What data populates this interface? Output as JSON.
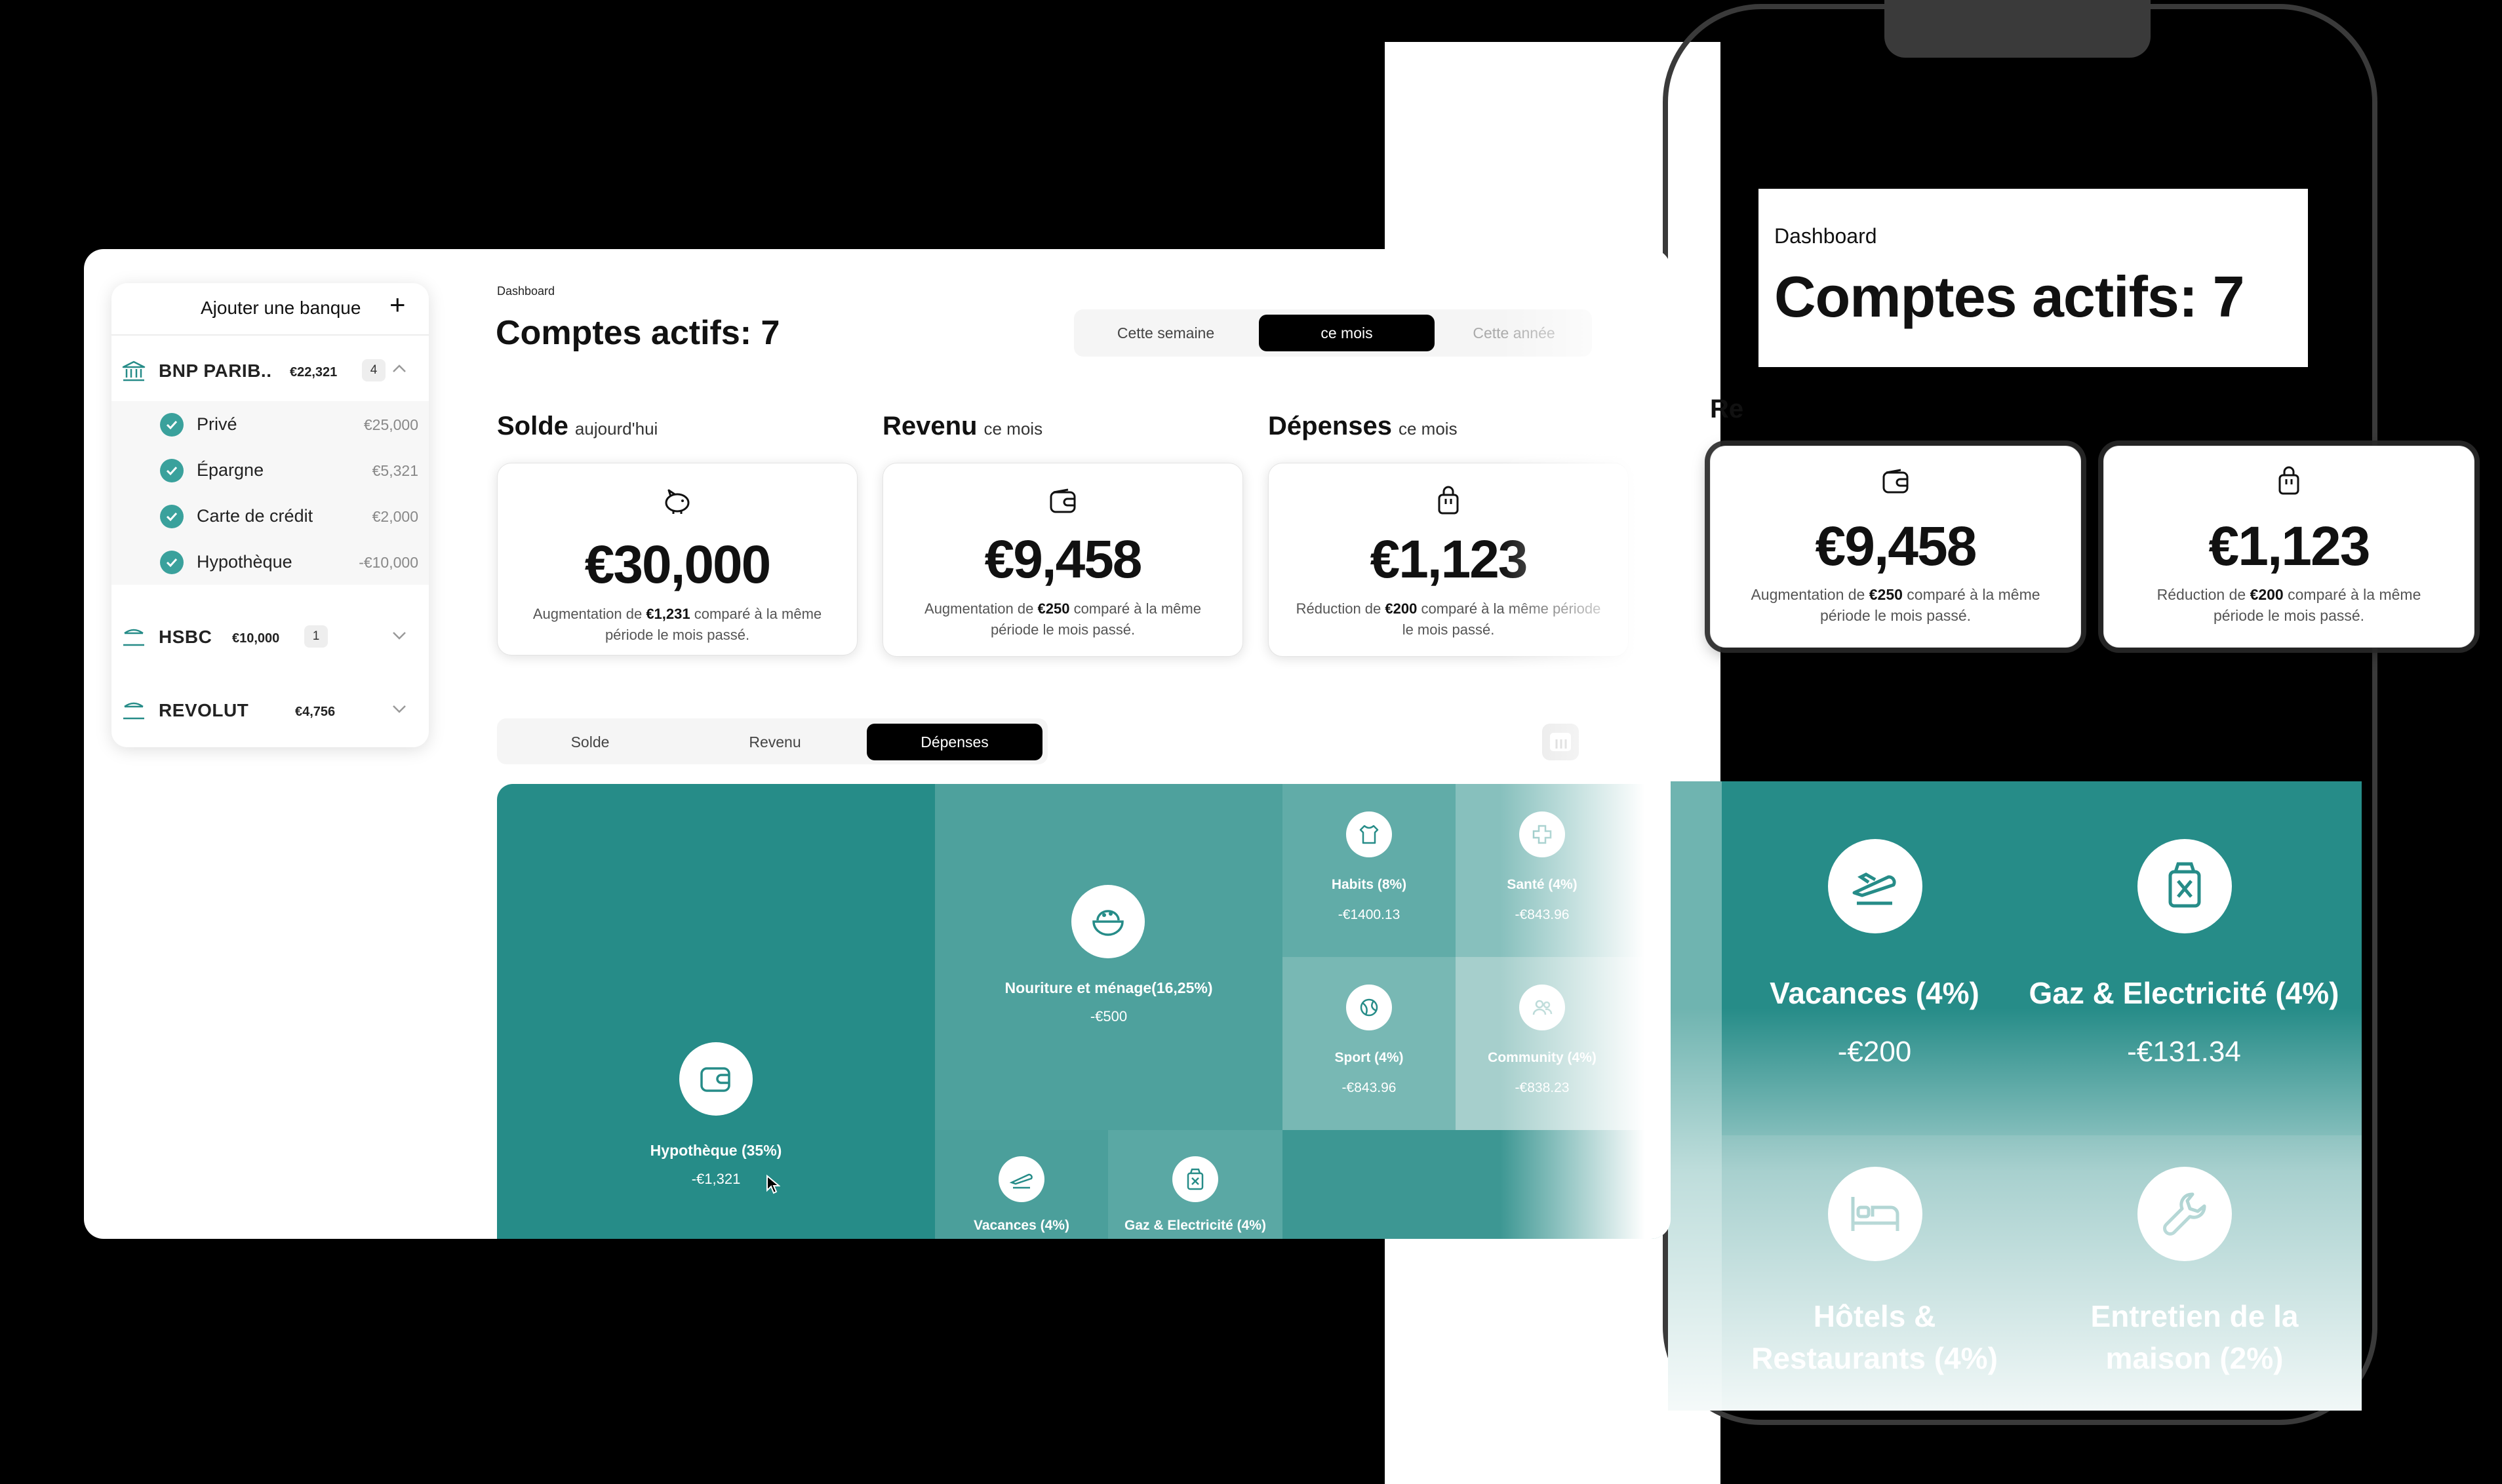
{
  "desktop": {
    "sidebar": {
      "add_bank_label": "Ajouter une banque",
      "add_icon": "+",
      "banks": [
        {
          "name": "BNP PARIB..",
          "amount": "€22,321",
          "count": "4",
          "expanded": true
        },
        {
          "name": "HSBC",
          "amount": "€10,000",
          "count": "1",
          "expanded": false
        },
        {
          "name": "REVOLUT",
          "amount": "€4,756",
          "count": "",
          "expanded": false
        }
      ],
      "bnp_accounts": [
        {
          "label": "Privé",
          "amount": "€25,000"
        },
        {
          "label": "Épargne",
          "amount": "€5,321"
        },
        {
          "label": "Carte de crédit",
          "amount": "€2,000"
        },
        {
          "label": "Hypothèque",
          "amount": "-€10,000"
        }
      ]
    },
    "header": {
      "breadcrumb": "Dashboard",
      "title": "Comptes actifs: 7"
    },
    "period_tabs": [
      "Cette semaine",
      "ce mois",
      "Cette année"
    ],
    "period_active": "ce mois",
    "kpis": [
      {
        "title": "Solde",
        "subtitle": "aujourd'hui",
        "value": "€30,000",
        "desc_pre": "Augmentation de",
        "desc_amt": "€1,231",
        "desc_post": "comparé à la même période le mois passé.",
        "icon": "piggy-bank-icon"
      },
      {
        "title": "Revenu",
        "subtitle": "ce mois",
        "value": "€9,458",
        "desc_pre": "Augmentation de",
        "desc_amt": "€250",
        "desc_post": "comparé à la même période le mois passé.",
        "icon": "wallet-icon"
      },
      {
        "title": "Dépenses",
        "subtitle": "ce mois",
        "value": "€1,123",
        "desc_pre": "Réduction de",
        "desc_amt": "€200",
        "desc_post": "comparé à la même période le mois passé.",
        "icon": "shopping-bag-icon"
      }
    ],
    "category_tabs": [
      "Solde",
      "Revenu",
      "Dépenses"
    ],
    "category_active": "Dépenses",
    "treemap": [
      {
        "name": "Hypothèque (35%)",
        "amount": "-€1,321",
        "icon": "wallet-icon",
        "color": "#268c88"
      },
      {
        "name": "Nouriture et ménage(16,25%)",
        "amount": "-€500",
        "icon": "food-bowl-icon",
        "color": "#4ea19d"
      },
      {
        "name": "Habits (8%)",
        "amount": "-€1400.13",
        "icon": "shirt-icon",
        "color": "#61aca8"
      },
      {
        "name": "Santé (4%)",
        "amount": "-€843.96",
        "icon": "health-cross-icon",
        "color": "#87c0bd"
      },
      {
        "name": "Sport (4%)",
        "amount": "-€843.96",
        "icon": "ball-icon",
        "color": "#78b8b4"
      },
      {
        "name": "Community (4%)",
        "amount": "-€838.23",
        "icon": "people-icon",
        "color": "#a6cfcc"
      },
      {
        "name": "Vacances (4%)",
        "amount": "",
        "icon": "plane-icon",
        "color": "#4b9f9b"
      },
      {
        "name": "Gaz & Electricité (4%)",
        "amount": "",
        "icon": "gas-can-icon",
        "color": "#5aa8a4"
      }
    ]
  },
  "phone": {
    "breadcrumb": "Dashboard",
    "title": "Comptes actifs: 7",
    "partial_heading": "Re",
    "cards": [
      {
        "value": "€9,458",
        "desc_pre": "Augmentation de",
        "desc_amt": "€250",
        "desc_post": "comparé à la même période le mois passé.",
        "icon": "wallet-icon"
      },
      {
        "value": "€1,123",
        "desc_pre": "Réduction de",
        "desc_amt": "€200",
        "desc_post": "comparé à la même période le mois passé.",
        "icon": "shopping-bag-icon"
      }
    ],
    "treemap": [
      {
        "name": "Vacances (4%)",
        "amount": "-€200",
        "icon": "plane-icon"
      },
      {
        "name": "Gaz & Electricité (4%)",
        "amount": "-€131.34",
        "icon": "gas-can-icon"
      },
      {
        "name": "Hôtels & Restaurants (4%)",
        "amount": "",
        "icon": "bed-icon"
      },
      {
        "name": "Entretien de la maison (2%)",
        "amount": "",
        "icon": "wrench-icon"
      }
    ]
  },
  "colors": {
    "accent": "#268c88",
    "active_tab": "#000000"
  }
}
